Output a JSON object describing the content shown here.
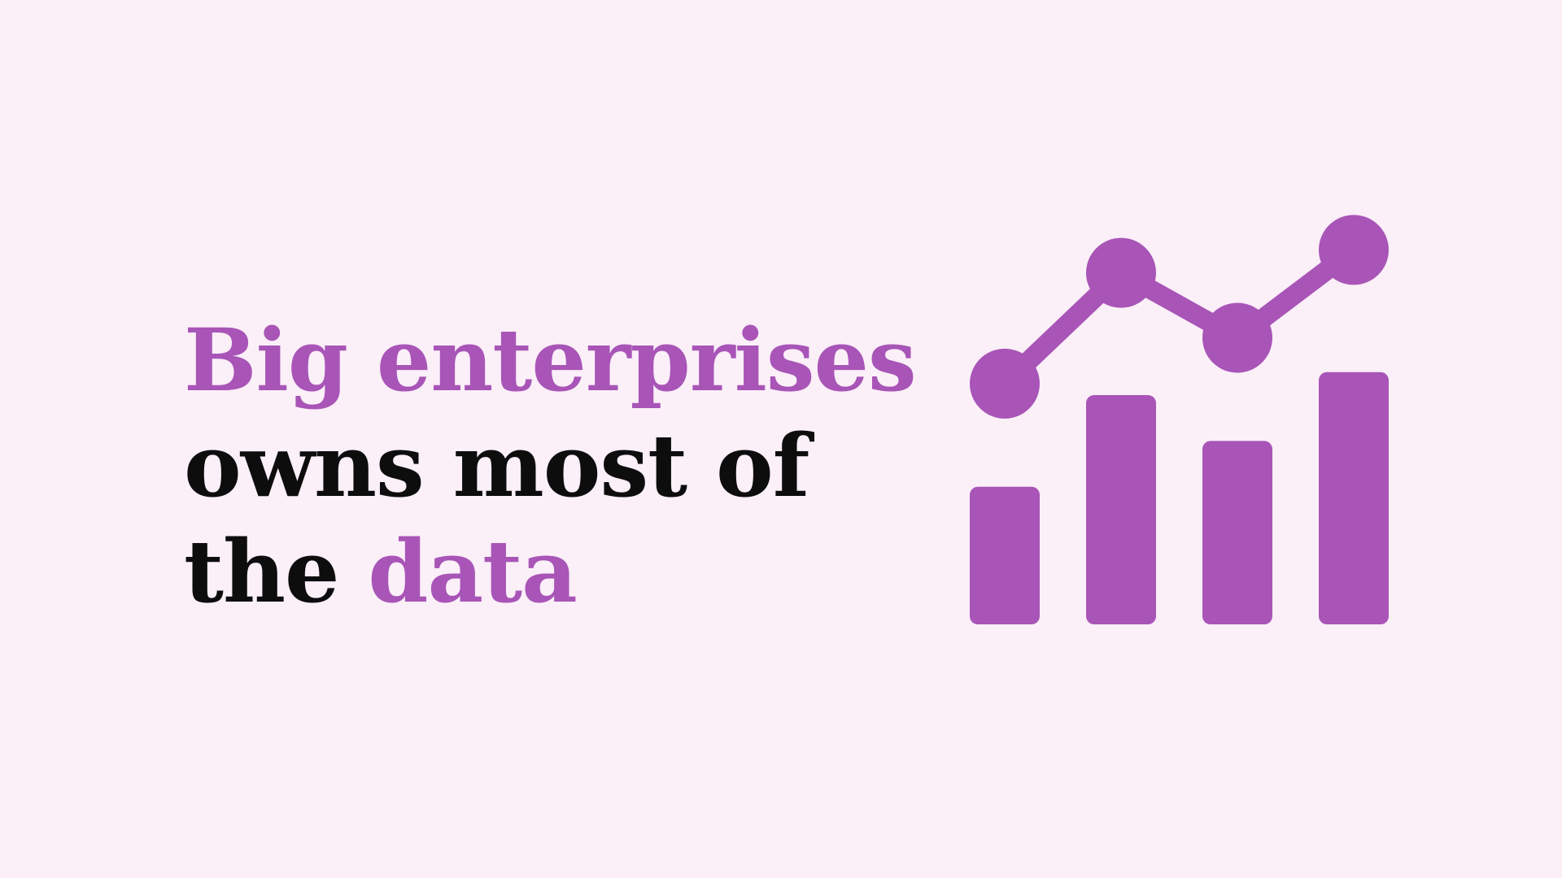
{
  "slide": {
    "background": "#fbeff8",
    "accent_color": "#a855b7",
    "text_color": "#0d0d0d",
    "headline": {
      "line1": {
        "accent": "Big enterprises"
      },
      "line2": {
        "text": "owns most of"
      },
      "line3": {
        "text": "the ",
        "accent": "data"
      }
    }
  },
  "icon": {
    "name": "bar-line-chart-icon",
    "bar_levels": [
      0.36,
      0.6,
      0.48,
      0.66
    ],
    "line_levels": [
      0.63,
      0.92,
      0.75,
      0.98
    ]
  }
}
